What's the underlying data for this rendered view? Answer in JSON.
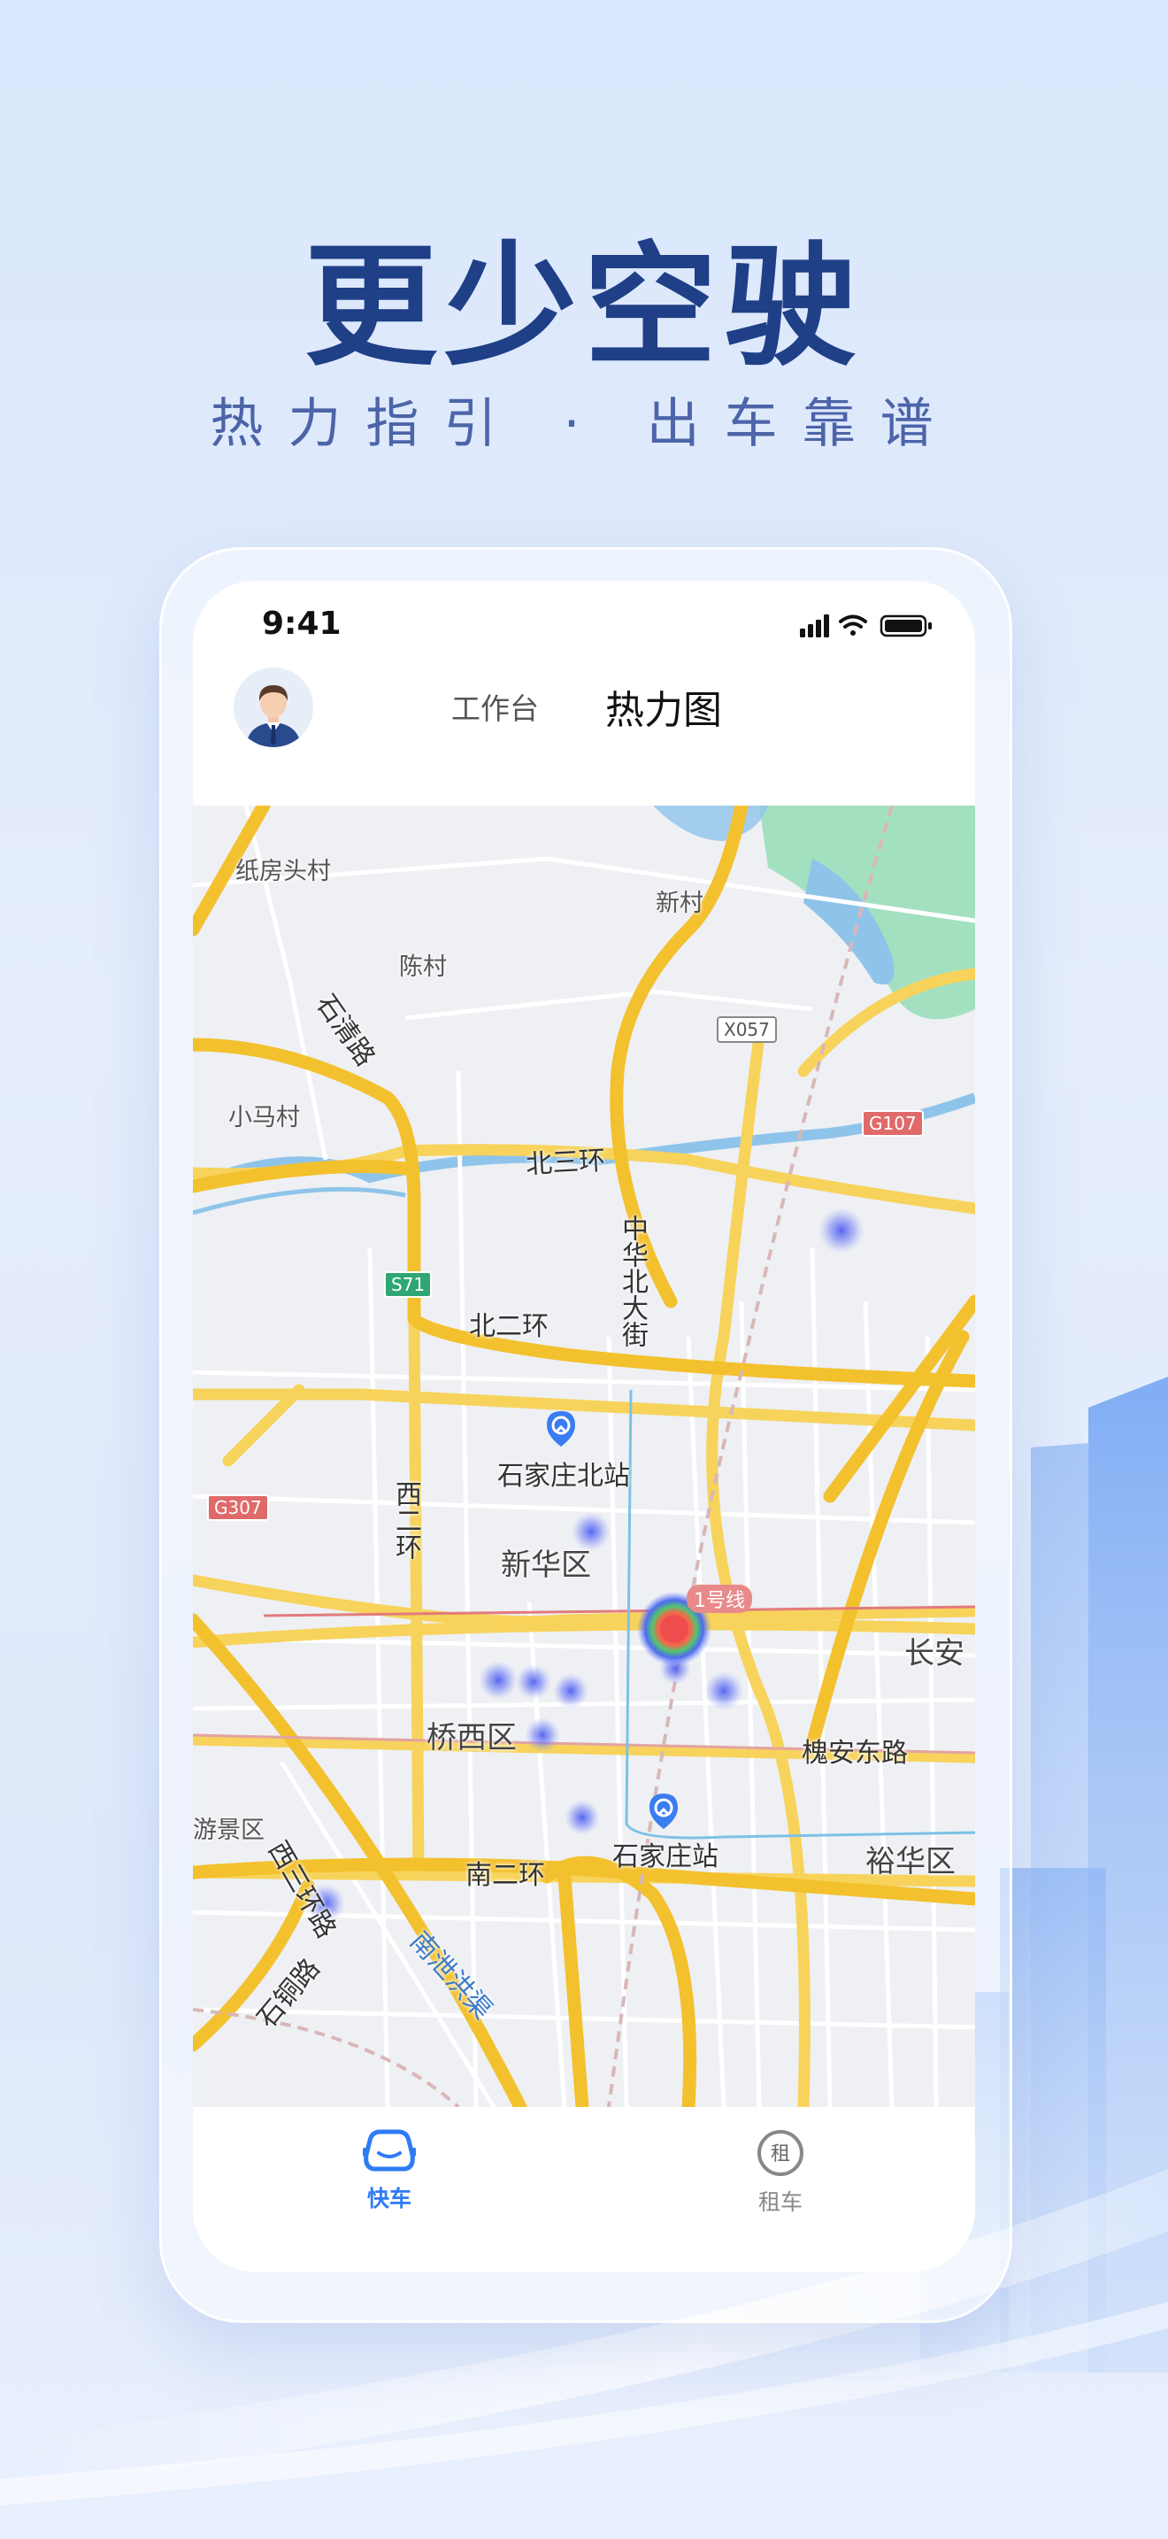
{
  "headline": "更少空驶",
  "subline": "热力指引 · 出车靠谱",
  "status_bar": {
    "time": "9:41"
  },
  "header": {
    "tab_workbench": "工作台",
    "tab_heatmap": "热力图"
  },
  "map": {
    "places": {
      "zhifangtoucun": "纸房头村",
      "xincun": "新村",
      "chencun": "陈村",
      "xiaomacun": "小马村",
      "xinhuaqu": "新华区",
      "qiaoxiqu": "桥西区",
      "yuhuaqu": "裕华区",
      "changan": "长安",
      "jingqu": "游景区"
    },
    "roads": {
      "shiqinglu": "石清路",
      "beisanhuan": "北三环",
      "beierhuan": "北二环",
      "xierhuan": "西二环",
      "zhonghuabeidajie": "中华北大街",
      "huaiandonglu": "槐安东路",
      "nanerhuan": "南二环",
      "xisanhuanlu": "西三环路",
      "shitonglu": "石铜路",
      "nanxiangqu": "南泄洪渠"
    },
    "shields": {
      "x057": "X057",
      "g107": "G107",
      "s71": "S71",
      "g307": "G307"
    },
    "line_label": "1号线",
    "stations": {
      "north": "石家庄北站",
      "main": "石家庄站"
    },
    "hotspots": [
      {
        "level": "high"
      },
      {
        "level": "low"
      },
      {
        "level": "low"
      },
      {
        "level": "low"
      },
      {
        "level": "low"
      },
      {
        "level": "low"
      },
      {
        "level": "low"
      },
      {
        "level": "low"
      },
      {
        "level": "low"
      },
      {
        "level": "low"
      }
    ]
  },
  "tabbar": {
    "tab_kuaiche": "快车",
    "tab_zuche": "租车",
    "zuche_icon_char": "租"
  },
  "colors": {
    "headline": "#1f3f87",
    "subline": "#4c64a8",
    "accent": "#2e7bf6",
    "road_major": "#f7d35b",
    "road_minor": "#ffffff",
    "water": "#8fc4ea",
    "park": "#9fdfb8",
    "hotspot_low": "#5a6cf0",
    "hotspot_high": "#ef4d4d"
  },
  "icons": {
    "avatar": "driver-avatar-icon",
    "kuaiche": "car-icon",
    "zuche": "rent-circle-icon",
    "signal": "signal-icon",
    "wifi": "wifi-icon",
    "battery": "battery-icon",
    "station": "railway-station-icon"
  }
}
